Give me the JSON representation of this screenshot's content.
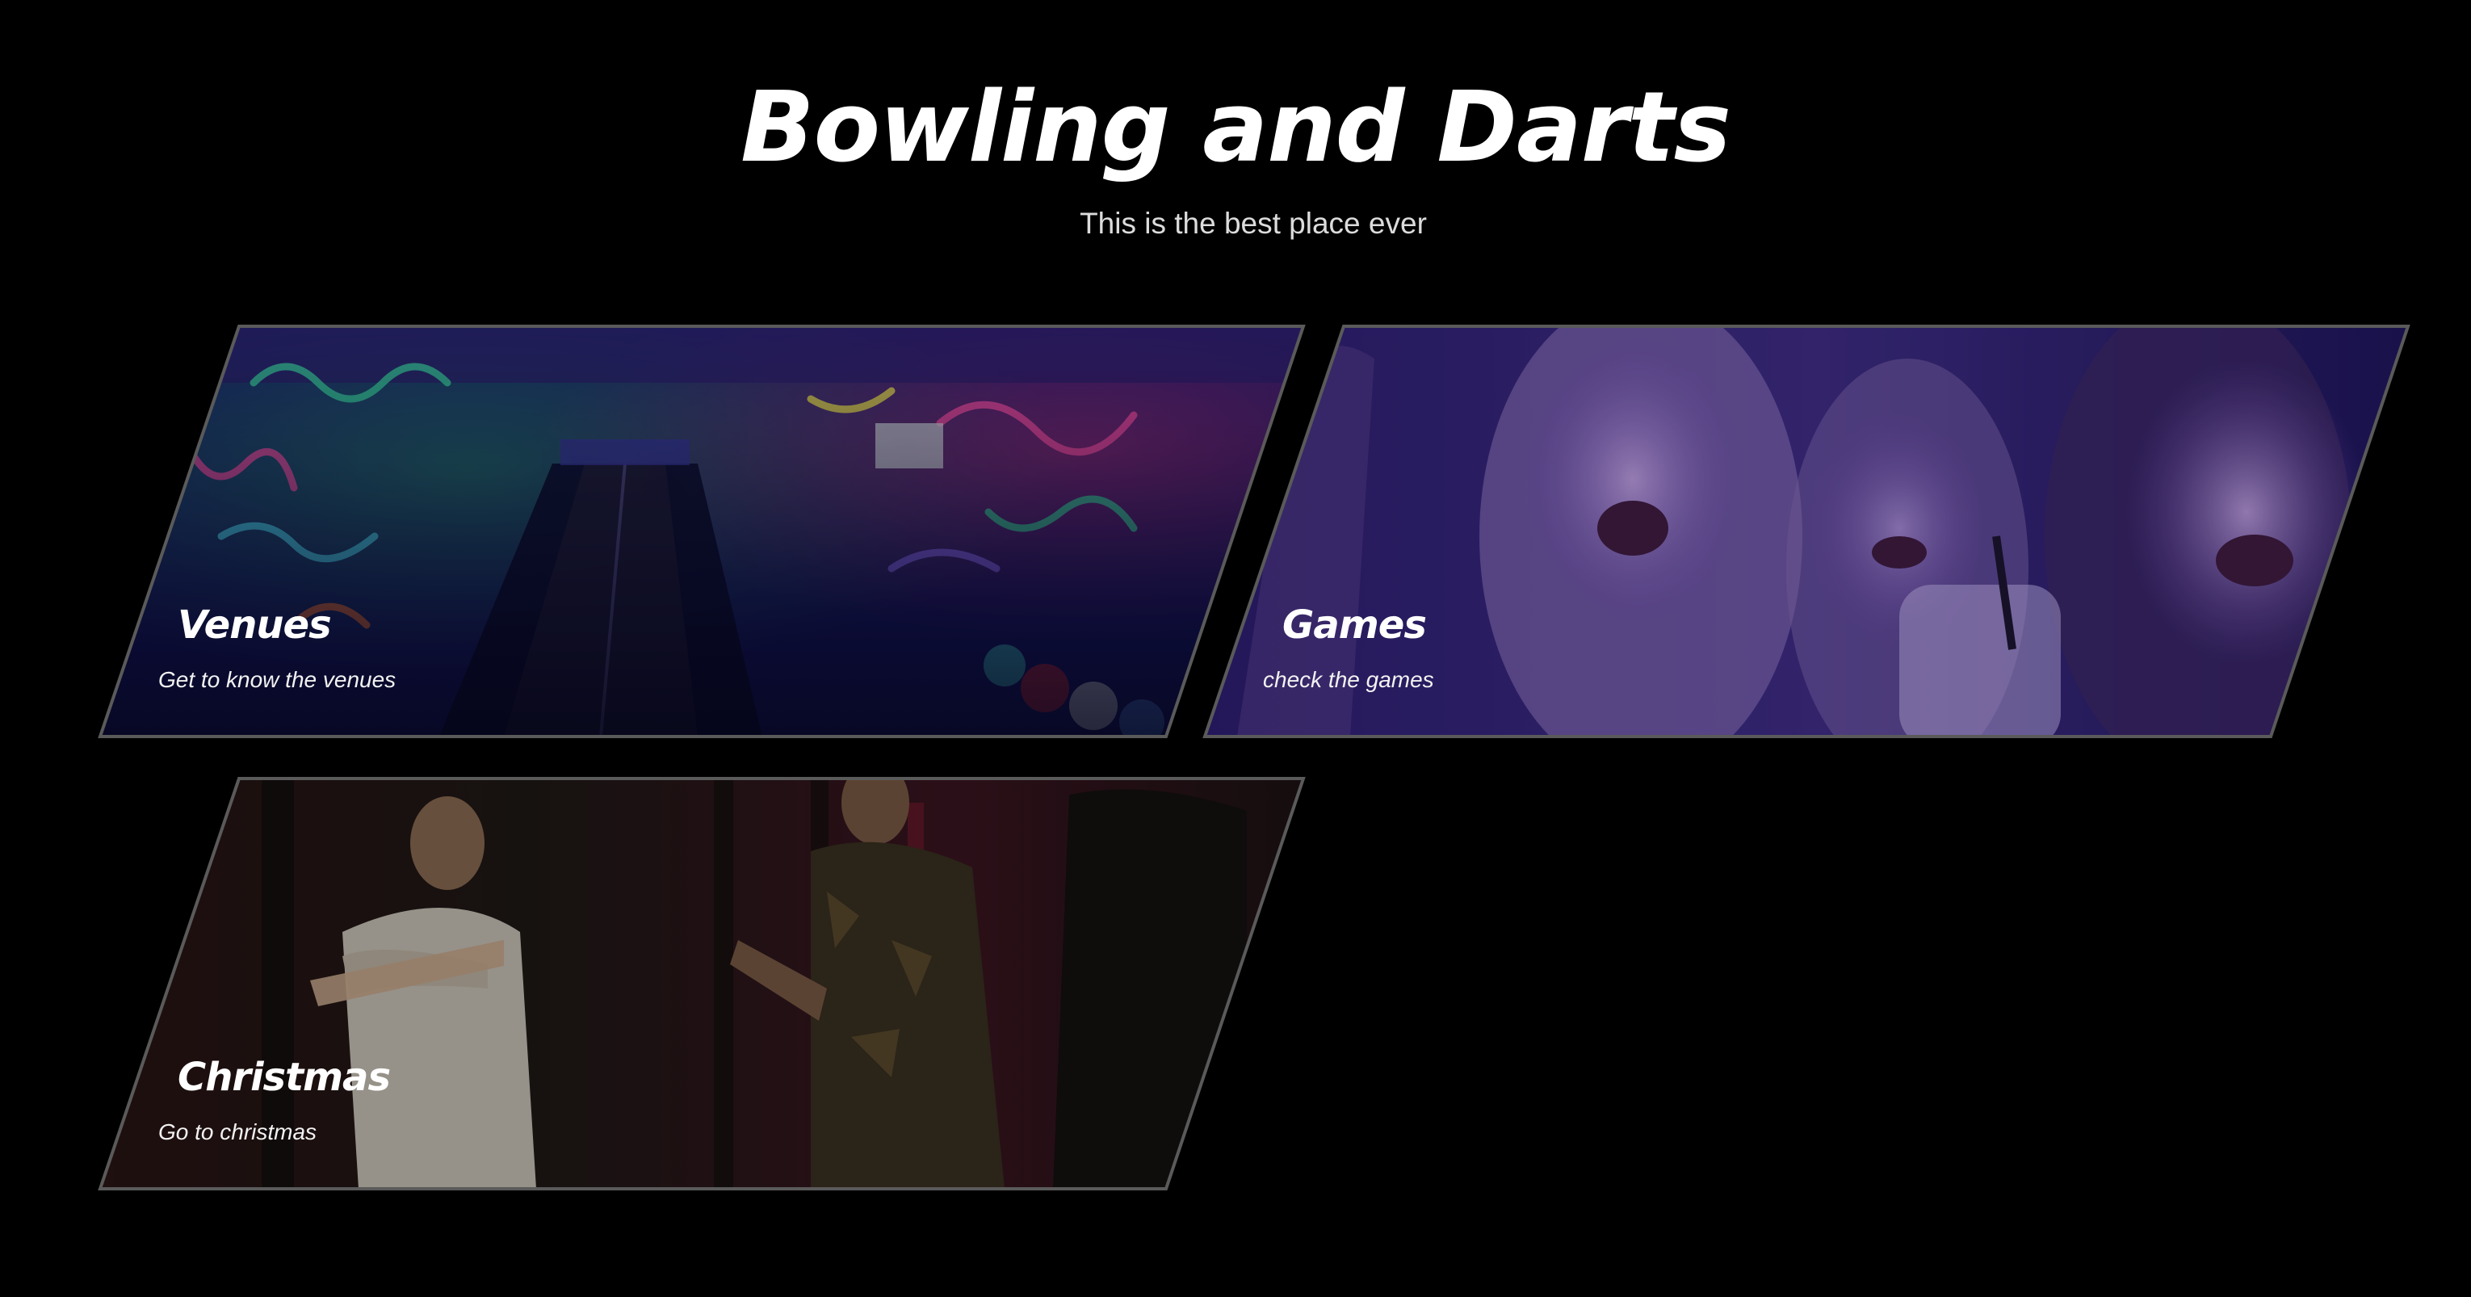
{
  "header": {
    "title": "Bowling and Darts",
    "subtitle": "This is the best place ever"
  },
  "cards": [
    {
      "title": "Venues",
      "description": "Get to know the venues",
      "image": "neon graffiti bowling alley"
    },
    {
      "title": "Games",
      "description": "check the games",
      "image": "laughing friends under purple lights"
    },
    {
      "title": "Christmas",
      "description": "Go to christmas",
      "image": "man throwing darts in a dark bar"
    }
  ],
  "colors": {
    "background": "#000000",
    "card_border": "#5a5a5a",
    "venues_tint": "#1a1a6e",
    "games_tint": "#4a2a8a",
    "christmas_tint": "#2a1c18"
  }
}
